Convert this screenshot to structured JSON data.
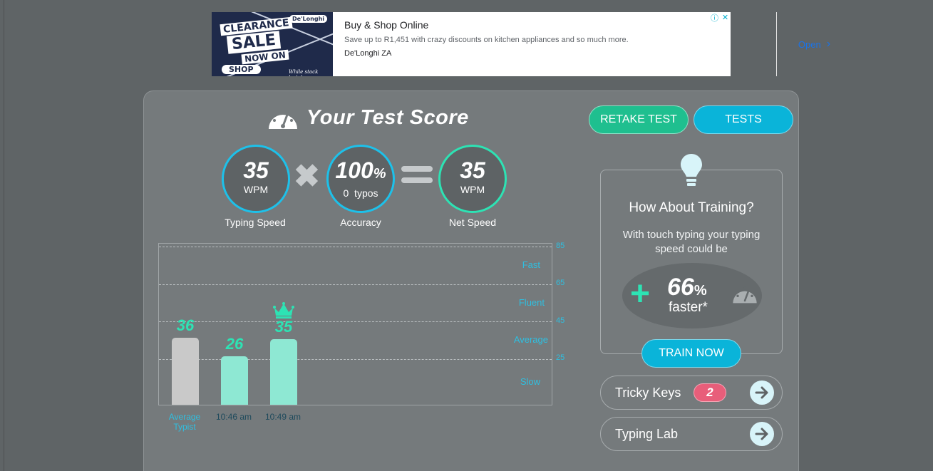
{
  "ad": {
    "image_words": [
      "CLEARANCE",
      "SALE",
      "NOW ON",
      "SHOP"
    ],
    "image_brand": "De'Longhi",
    "image_footer": "While stock lasts!",
    "title": "Buy & Shop Online",
    "description": "Save up to R1,451 with crazy discounts on kitchen appliances and so much more.",
    "source": "De'Longhi ZA",
    "open_label": "Open",
    "info_icon": "info-icon",
    "close_icon": "close-icon"
  },
  "header": {
    "title": "Your Test Score",
    "retake_label": "RETAKE TEST",
    "tests_label": "TESTS"
  },
  "score": {
    "typing_speed": {
      "value": "35",
      "unit": "WPM",
      "label": "Typing Speed"
    },
    "accuracy": {
      "value": "100",
      "percent": "%",
      "typos": "0  typos",
      "label": "Accuracy"
    },
    "net_speed": {
      "value": "35",
      "unit": "WPM",
      "label": "Net Speed"
    }
  },
  "chart_data": {
    "type": "bar",
    "categories": [
      "Average Typist",
      "10:46 am",
      "10:49 am"
    ],
    "values": [
      36,
      26,
      35
    ],
    "value_labels": [
      "36",
      "26",
      "35"
    ],
    "ylim": [
      0,
      85
    ],
    "y_ticks": [
      "85",
      "65",
      "45",
      "25"
    ],
    "bands": [
      "Fast",
      "Fluent",
      "Average",
      "Slow"
    ],
    "grid": true,
    "best_marker": "crown-icon",
    "colors": {
      "average": "#c9c9c9",
      "tests": "#8ee8d3",
      "labels": "#2de3b4"
    }
  },
  "training": {
    "title": "How About Training?",
    "text": "With touch typing your typing speed could be",
    "percent": "66",
    "percent_sign": "%",
    "faster": "faster*",
    "train_label": "TRAIN NOW"
  },
  "links": [
    {
      "label": "Tricky Keys",
      "badge": "2"
    },
    {
      "label": "Typing Lab"
    }
  ]
}
